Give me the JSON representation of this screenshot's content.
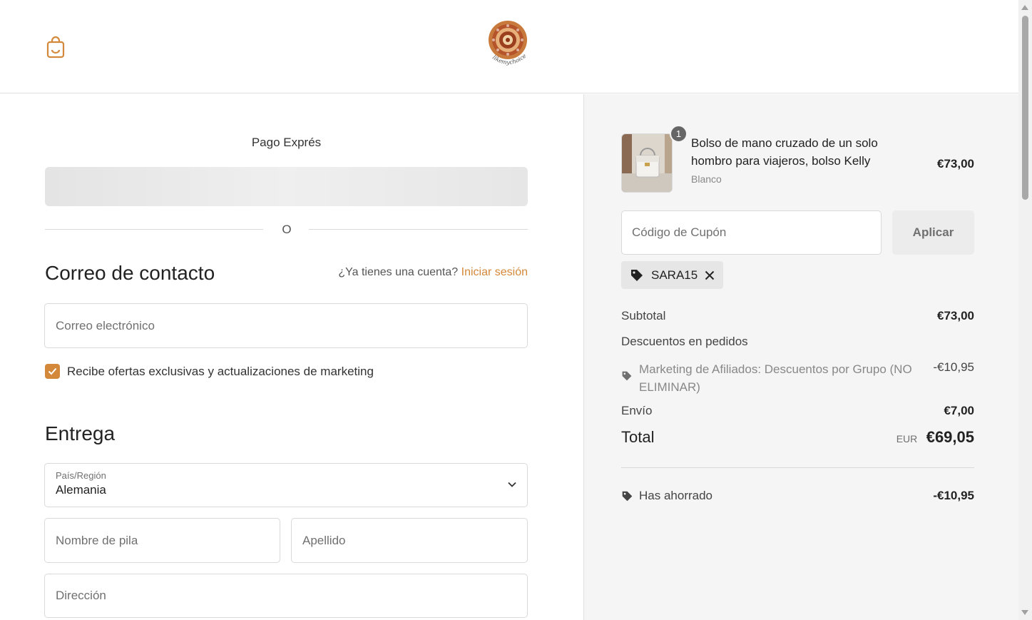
{
  "header": {
    "cart_icon": "shopping-bag-icon",
    "logo_text": "likemychoice"
  },
  "checkout": {
    "express_title": "Pago Exprés",
    "divider_text": "O",
    "contact_heading": "Correo de contacto",
    "account_question": "¿Ya tienes una cuenta?",
    "login_link": "Iniciar sesión",
    "email_placeholder": "Correo electrónico",
    "marketing_label": "Recibe ofertas exclusivas y actualizaciones de marketing",
    "marketing_checked": true,
    "delivery_heading": "Entrega",
    "country_label": "País/Región",
    "country_value": "Alemania",
    "first_name_placeholder": "Nombre de pila",
    "last_name_placeholder": "Apellido",
    "address_placeholder": "Dirección"
  },
  "summary": {
    "item": {
      "quantity": "1",
      "name": "Bolso de mano cruzado de un solo hombro para viajeros, bolso Kelly",
      "variant": "Blanco",
      "price": "€73,00"
    },
    "coupon_placeholder": "Código de Cupón",
    "apply_label": "Aplicar",
    "applied_code": "SARA15",
    "subtotal_label": "Subtotal",
    "subtotal_value": "€73,00",
    "order_discounts_label": "Descuentos en pedidos",
    "discount_name": "Marketing de Afiliados: Descuentos por Grupo (NO ELIMINAR)",
    "discount_value": "-€10,95",
    "shipping_label": "Envío",
    "shipping_value": "€7,00",
    "total_label": "Total",
    "total_currency": "EUR",
    "total_value": "€69,05",
    "saved_label": "Has ahorrado",
    "saved_value": "-€10,95"
  },
  "colors": {
    "accent": "#d4883a",
    "summary_bg": "#f5f5f5"
  }
}
